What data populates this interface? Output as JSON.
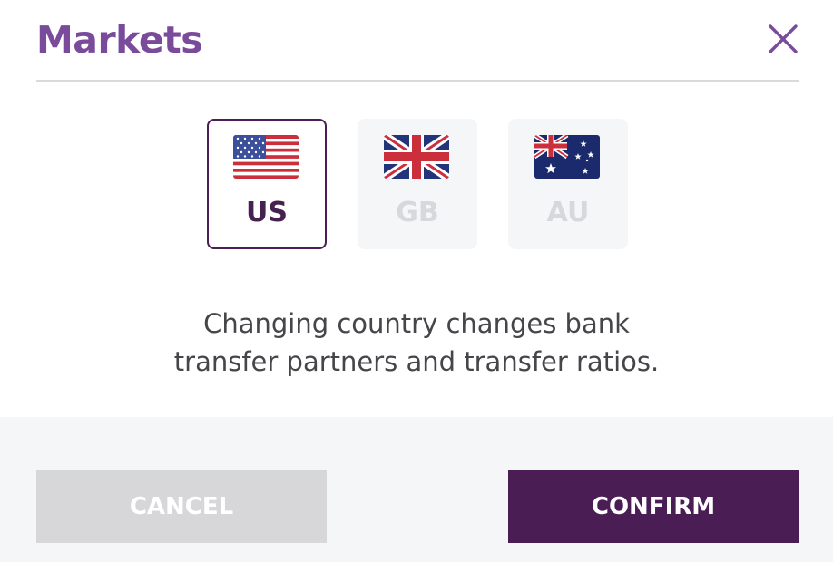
{
  "modal": {
    "title": "Markets",
    "close_icon": "close-x-icon"
  },
  "markets": [
    {
      "code": "US",
      "flag_icon": "us-flag-icon",
      "selected": true
    },
    {
      "code": "GB",
      "flag_icon": "gb-flag-icon",
      "selected": false
    },
    {
      "code": "AU",
      "flag_icon": "au-flag-icon",
      "selected": false
    }
  ],
  "description": {
    "line1": "Changing country changes bank",
    "line2": "transfer partners and transfer ratios."
  },
  "footer": {
    "cancel_label": "CANCEL",
    "confirm_label": "CONFIRM"
  },
  "colors": {
    "title": "#7a4b9b",
    "accent": "#4a1d55",
    "disabled": "#d7d7d9",
    "footer_bg": "#f5f6f8"
  }
}
